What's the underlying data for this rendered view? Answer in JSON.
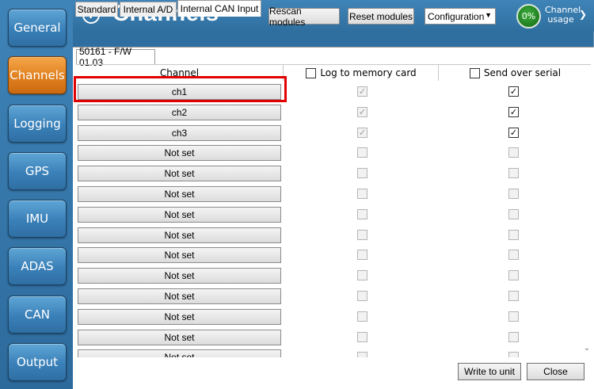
{
  "sidebar": {
    "items": [
      {
        "label": "General",
        "active": false
      },
      {
        "label": "Channels",
        "active": true
      },
      {
        "label": "Logging",
        "active": false
      },
      {
        "label": "GPS",
        "active": false
      },
      {
        "label": "IMU",
        "active": false
      },
      {
        "label": "ADAS",
        "active": false
      },
      {
        "label": "CAN",
        "active": false
      },
      {
        "label": "Output",
        "active": false
      }
    ]
  },
  "header": {
    "title": "Channels",
    "help_icon": "question-icon",
    "rescan_label": "Rescan modules",
    "reset_label": "Reset modules",
    "config_value": "Configuration",
    "usage_percent": "0%",
    "usage_label": "Channel usage"
  },
  "tabs": [
    {
      "label": "Standard",
      "active": false
    },
    {
      "label": "Internal A/D",
      "active": false
    },
    {
      "label": "Internal CAN Input",
      "active": true
    }
  ],
  "subtab": {
    "label": "50161 - F/W 01.03"
  },
  "grid": {
    "headers": {
      "channel": "Channel",
      "log": "Log to memory card",
      "send": "Send over serial"
    },
    "rows": [
      {
        "name": "ch1",
        "log": true,
        "send": true,
        "enabled": true
      },
      {
        "name": "ch2",
        "log": true,
        "send": true,
        "enabled": true
      },
      {
        "name": "ch3",
        "log": true,
        "send": true,
        "enabled": true
      },
      {
        "name": "Not set",
        "log": false,
        "send": false,
        "enabled": false
      },
      {
        "name": "Not set",
        "log": false,
        "send": false,
        "enabled": false
      },
      {
        "name": "Not set",
        "log": false,
        "send": false,
        "enabled": false
      },
      {
        "name": "Not set",
        "log": false,
        "send": false,
        "enabled": false
      },
      {
        "name": "Not set",
        "log": false,
        "send": false,
        "enabled": false
      },
      {
        "name": "Not set",
        "log": false,
        "send": false,
        "enabled": false
      },
      {
        "name": "Not set",
        "log": false,
        "send": false,
        "enabled": false
      },
      {
        "name": "Not set",
        "log": false,
        "send": false,
        "enabled": false
      },
      {
        "name": "Not set",
        "log": false,
        "send": false,
        "enabled": false
      },
      {
        "name": "Not set",
        "log": false,
        "send": false,
        "enabled": false
      },
      {
        "name": "Not set",
        "log": false,
        "send": false,
        "enabled": false
      }
    ]
  },
  "footer": {
    "write_label": "Write to unit",
    "close_label": "Close"
  },
  "colors": {
    "accent": "#2f6f9f",
    "active_nav": "#e0801f",
    "highlight": "#e00000"
  }
}
